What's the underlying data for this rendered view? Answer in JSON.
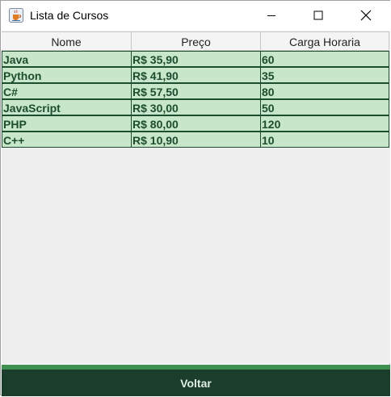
{
  "window": {
    "title": "Lista de Cursos",
    "icon": "java-cup-icon"
  },
  "table": {
    "columns": [
      "Nome",
      "Preço",
      "Carga Horaria"
    ],
    "rows": [
      [
        "Java",
        "R$ 35,90",
        "60"
      ],
      [
        "Python",
        "R$ 41,90",
        "35"
      ],
      [
        "C#",
        "R$ 57,50",
        "80"
      ],
      [
        "JavaScript",
        "R$ 30,00",
        "50"
      ],
      [
        "PHP",
        "R$ 80,00",
        "120"
      ],
      [
        "C++",
        "R$ 10,90",
        "10"
      ]
    ]
  },
  "footer": {
    "back_label": "Voltar"
  },
  "colors": {
    "row_bg": "#c8e6c9",
    "row_text": "#1b4d2e",
    "button_bg": "#1b3d2b",
    "accent_strip": "#3e8f50"
  }
}
